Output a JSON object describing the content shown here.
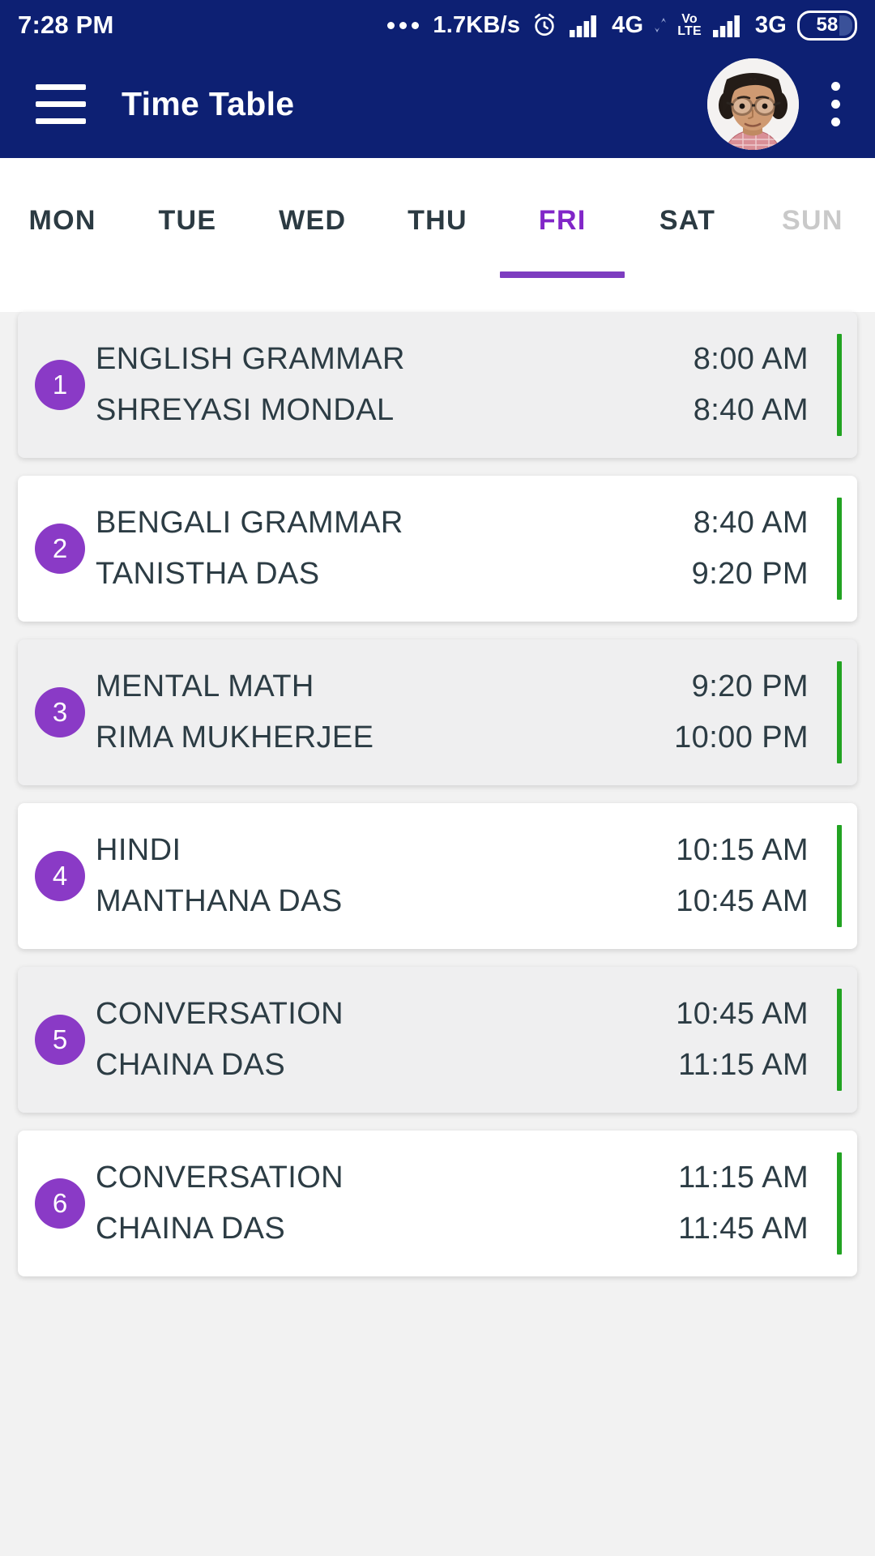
{
  "status_bar": {
    "time": "7:28 PM",
    "overflow_dots": "...",
    "network_speed": "1.7KB/s",
    "alarm_icon": "alarm-clock-icon",
    "signal_1_label": "4G",
    "volte_top": "Vo",
    "volte_bottom": "LTE",
    "signal_2_label": "3G",
    "battery_level": "58"
  },
  "app_bar": {
    "menu_icon": "hamburger-menu-icon",
    "title": "Time Table",
    "avatar_alt": "student-profile-photo",
    "overflow_icon": "more-vertical-icon"
  },
  "tabs": {
    "items": [
      {
        "label": "MON",
        "state": "normal"
      },
      {
        "label": "TUE",
        "state": "normal"
      },
      {
        "label": "WED",
        "state": "normal"
      },
      {
        "label": "THU",
        "state": "normal"
      },
      {
        "label": "FRI",
        "state": "active"
      },
      {
        "label": "SAT",
        "state": "normal"
      },
      {
        "label": "SUN",
        "state": "disabled"
      }
    ],
    "active_index": 4,
    "indicator_color": "#7d3cc0"
  },
  "colors": {
    "app_bar": "#0d2073",
    "accent_purple": "#8a3ac6",
    "tab_active": "#8126c8",
    "period_bar_green": "#22a322",
    "card_alt": "#efeff0",
    "card_plain": "#ffffff",
    "page_background": "#f2f2f2"
  },
  "schedule": {
    "periods": [
      {
        "number": "1",
        "subject": "ENGLISH GRAMMAR",
        "teacher": "SHREYASI MONDAL",
        "start_time": "8:00 AM",
        "end_time": "8:40 AM"
      },
      {
        "number": "2",
        "subject": "BENGALI GRAMMAR",
        "teacher": "TANISTHA DAS",
        "start_time": "8:40 AM",
        "end_time": "9:20 PM"
      },
      {
        "number": "3",
        "subject": "MENTAL MATH",
        "teacher": "RIMA MUKHERJEE",
        "start_time": "9:20 PM",
        "end_time": "10:00 PM"
      },
      {
        "number": "4",
        "subject": "HINDI",
        "teacher": "MANTHANA DAS",
        "start_time": "10:15 AM",
        "end_time": "10:45 AM"
      },
      {
        "number": "5",
        "subject": "CONVERSATION",
        "teacher": "CHAINA DAS",
        "start_time": "10:45 AM",
        "end_time": "11:15 AM"
      },
      {
        "number": "6",
        "subject": "CONVERSATION",
        "teacher": "CHAINA DAS",
        "start_time": "11:15 AM",
        "end_time": "11:45 AM"
      }
    ]
  }
}
